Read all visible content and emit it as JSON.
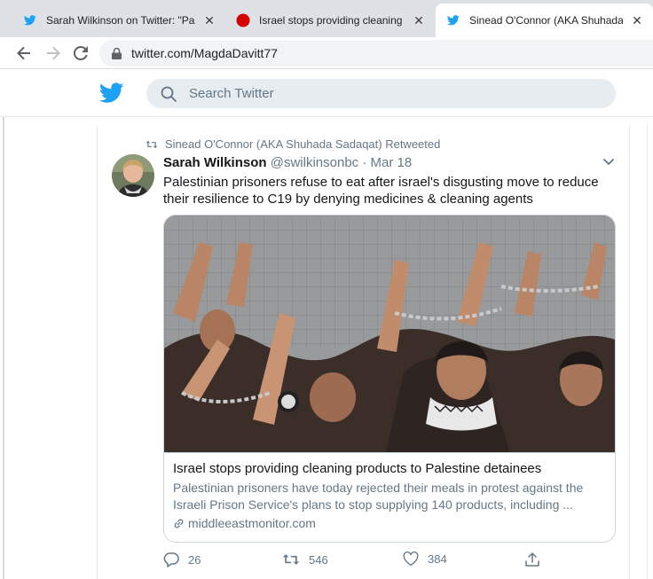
{
  "browser": {
    "tabs": [
      {
        "title": "Sarah Wilkinson on Twitter: \"Palestinian",
        "favicon": "twitter-bird-icon",
        "active": false
      },
      {
        "title": "Israel stops providing cleaning products",
        "favicon": "red-circle-icon",
        "active": false
      },
      {
        "title": "Sinead O'Connor (AKA Shuhada Sadaqat)",
        "favicon": "twitter-bird-icon",
        "active": true
      }
    ],
    "close_glyph": "✕",
    "url": "twitter.com/MagdaDavitt77"
  },
  "twitter": {
    "search_placeholder": "Search Twitter",
    "brand_color": "#1da1f2"
  },
  "tweet": {
    "retweeted_by": "Sinead O'Connor (AKA Shuhada Sadaqat) Retweeted",
    "author_name": "Sarah Wilkinson",
    "author_handle": "@swilkinsonbc",
    "separator": "·",
    "date": "Mar 18",
    "text": "Palestinian prisoners refuse to eat after israel's disgusting move to reduce their resilience to C19 by denying medicines & cleaning agents",
    "card": {
      "title": "Israel stops providing cleaning products to Palestine detainees",
      "description": "Palestinian prisoners have today rejected their meals in protest against the Israeli Prison Service's plans to stop supplying 140 products, including ...",
      "domain": "middleeastmonitor.com"
    },
    "replies": "26",
    "retweets": "546",
    "likes": "384"
  }
}
